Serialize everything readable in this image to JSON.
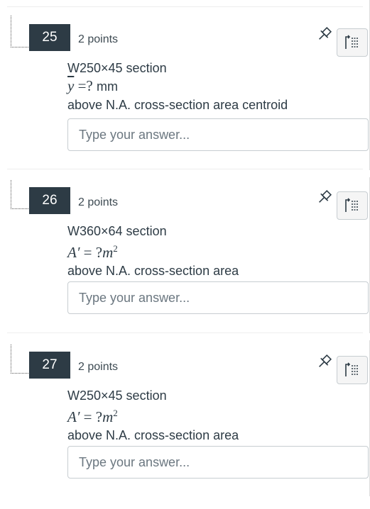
{
  "questions": [
    {
      "number": "25",
      "points": "2 points",
      "section": "W250×45 section",
      "formula_symbol": "y",
      "formula_value": "=?",
      "formula_unit": "mm",
      "formula_power": "",
      "description": "above N.A. cross-section area centroid",
      "answer_placeholder": "Type your answer..."
    },
    {
      "number": "26",
      "points": "2 points",
      "section": "W360×64 section",
      "formula_symbol": "A′",
      "formula_value": "= ?",
      "formula_unit": "m",
      "formula_power": "2",
      "description": "above N.A. cross-section area",
      "answer_placeholder": "Type your answer..."
    },
    {
      "number": "27",
      "points": "2 points",
      "section": "W250×45 section",
      "formula_symbol": "A′",
      "formula_value": "= ?",
      "formula_unit": "m",
      "formula_power": "2",
      "description": "above N.A. cross-section area",
      "answer_placeholder": "Type your answer..."
    }
  ],
  "icons": {
    "pin": "pin-icon",
    "flag": "flag-question-icon"
  },
  "colors": {
    "number_badge": "#2d3b45",
    "text": "#2d3b45",
    "border": "#c7cdd1"
  }
}
